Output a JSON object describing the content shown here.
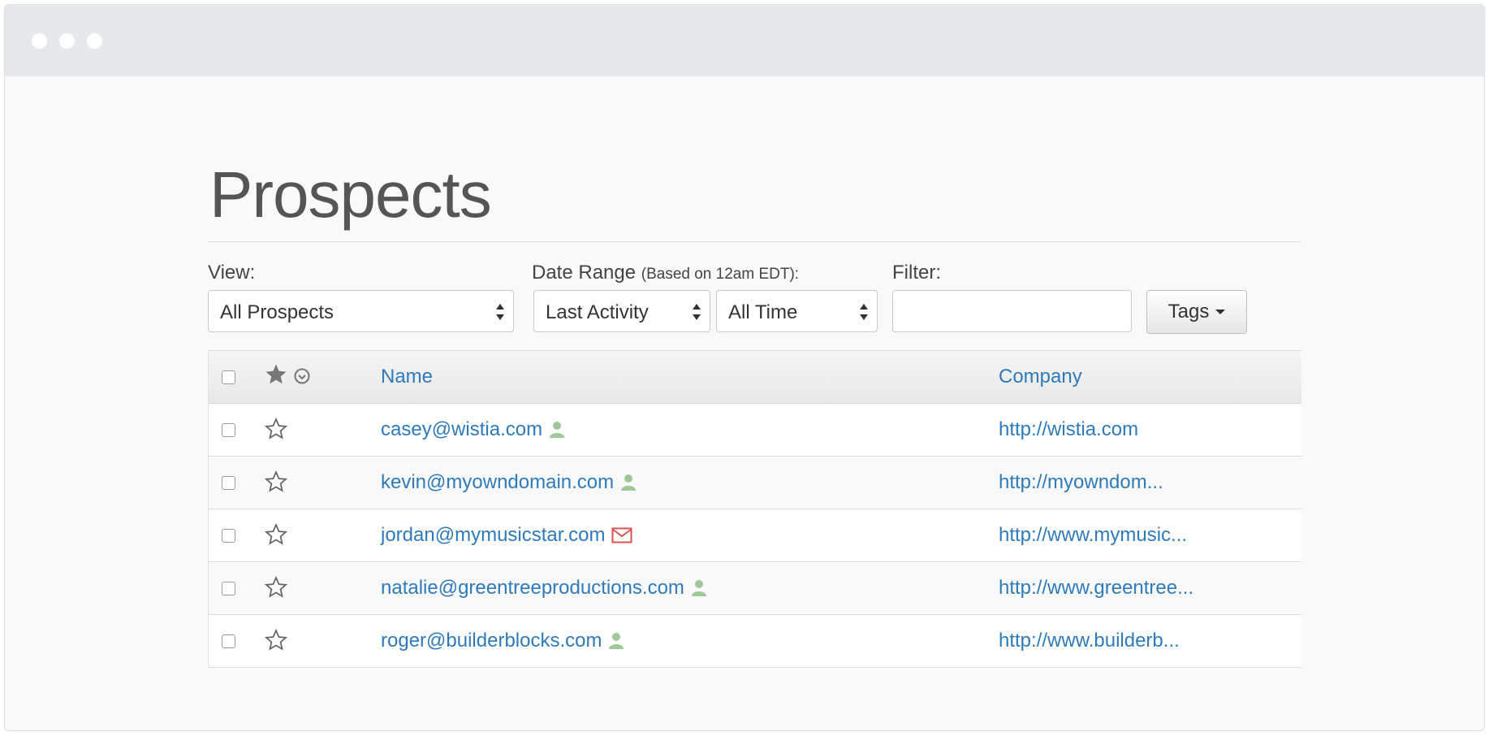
{
  "window": {
    "controls": [
      "close",
      "minimize",
      "maximize"
    ]
  },
  "page": {
    "title": "Prospects"
  },
  "filters": {
    "view_label": "View:",
    "view_value": "All Prospects",
    "date_range_label": "Date Range",
    "date_range_note": "(Based on 12am EDT):",
    "date_field_value": "Last Activity",
    "date_period_value": "All Time",
    "filter_label": "Filter:",
    "filter_value": "",
    "tags_label": "Tags"
  },
  "table": {
    "columns": {
      "name": "Name",
      "company": "Company"
    },
    "rows": [
      {
        "email": "casey@wistia.com",
        "company": "http://wistia.com",
        "badge": "person-icon"
      },
      {
        "email": "kevin@myowndomain.com",
        "company": "http://myowndom...",
        "badge": "person-icon"
      },
      {
        "email": "jordan@mymusicstar.com",
        "company": "http://www.mymusic...",
        "badge": "envelope-icon"
      },
      {
        "email": "natalie@greentreeproductions.com",
        "company": "http://www.greentree...",
        "badge": "person-icon"
      },
      {
        "email": "roger@builderblocks.com",
        "company": "http://www.builderb...",
        "badge": "person-icon"
      }
    ]
  },
  "colors": {
    "link": "#2f7ab9",
    "person_badge": "#9fc79a",
    "email_badge": "#d9534f"
  }
}
